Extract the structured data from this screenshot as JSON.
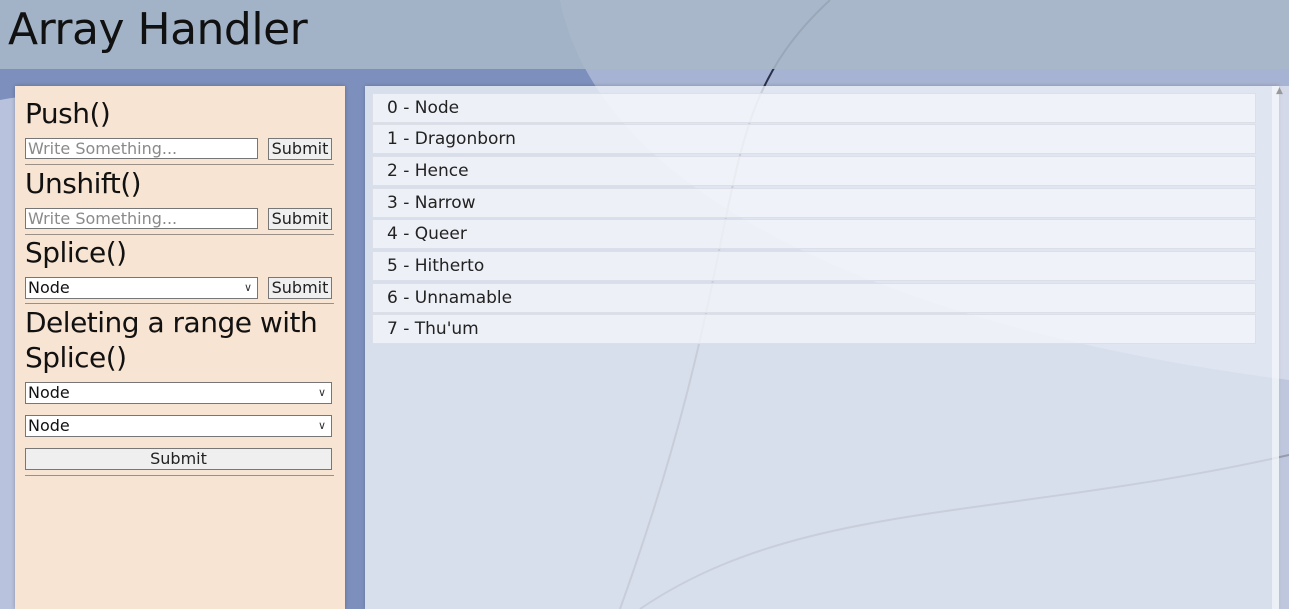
{
  "app": {
    "title": "Array Handler"
  },
  "push": {
    "heading": "Push()",
    "placeholder": "Write Something...",
    "submit_label": "Submit"
  },
  "unshift": {
    "heading": "Unshift()",
    "placeholder": "Write Something...",
    "submit_label": "Submit"
  },
  "splice": {
    "heading": "Splice()",
    "selected": "Node",
    "submit_label": "Submit"
  },
  "range": {
    "heading": "Deleting a range with Splice()",
    "start_selected": "Node",
    "end_selected": "Node",
    "submit_label": "Submit"
  },
  "list": {
    "items": [
      "0 - Node",
      "1 - Dragonborn",
      "2 - Hence",
      "3 - Narrow",
      "4 - Queer",
      "5 - Hitherto",
      "6 - Unnamable",
      "7 - Thu'um"
    ]
  },
  "icons": {
    "dropdown": "chevron-down-icon",
    "scroll_up": "scroll-up-arrow-icon"
  },
  "colors": {
    "header_bg": "#a8b8c8",
    "controls_bg": "#f8e4d2",
    "list_bg": "#eceff8",
    "page_bg": "#7d8fbd"
  }
}
